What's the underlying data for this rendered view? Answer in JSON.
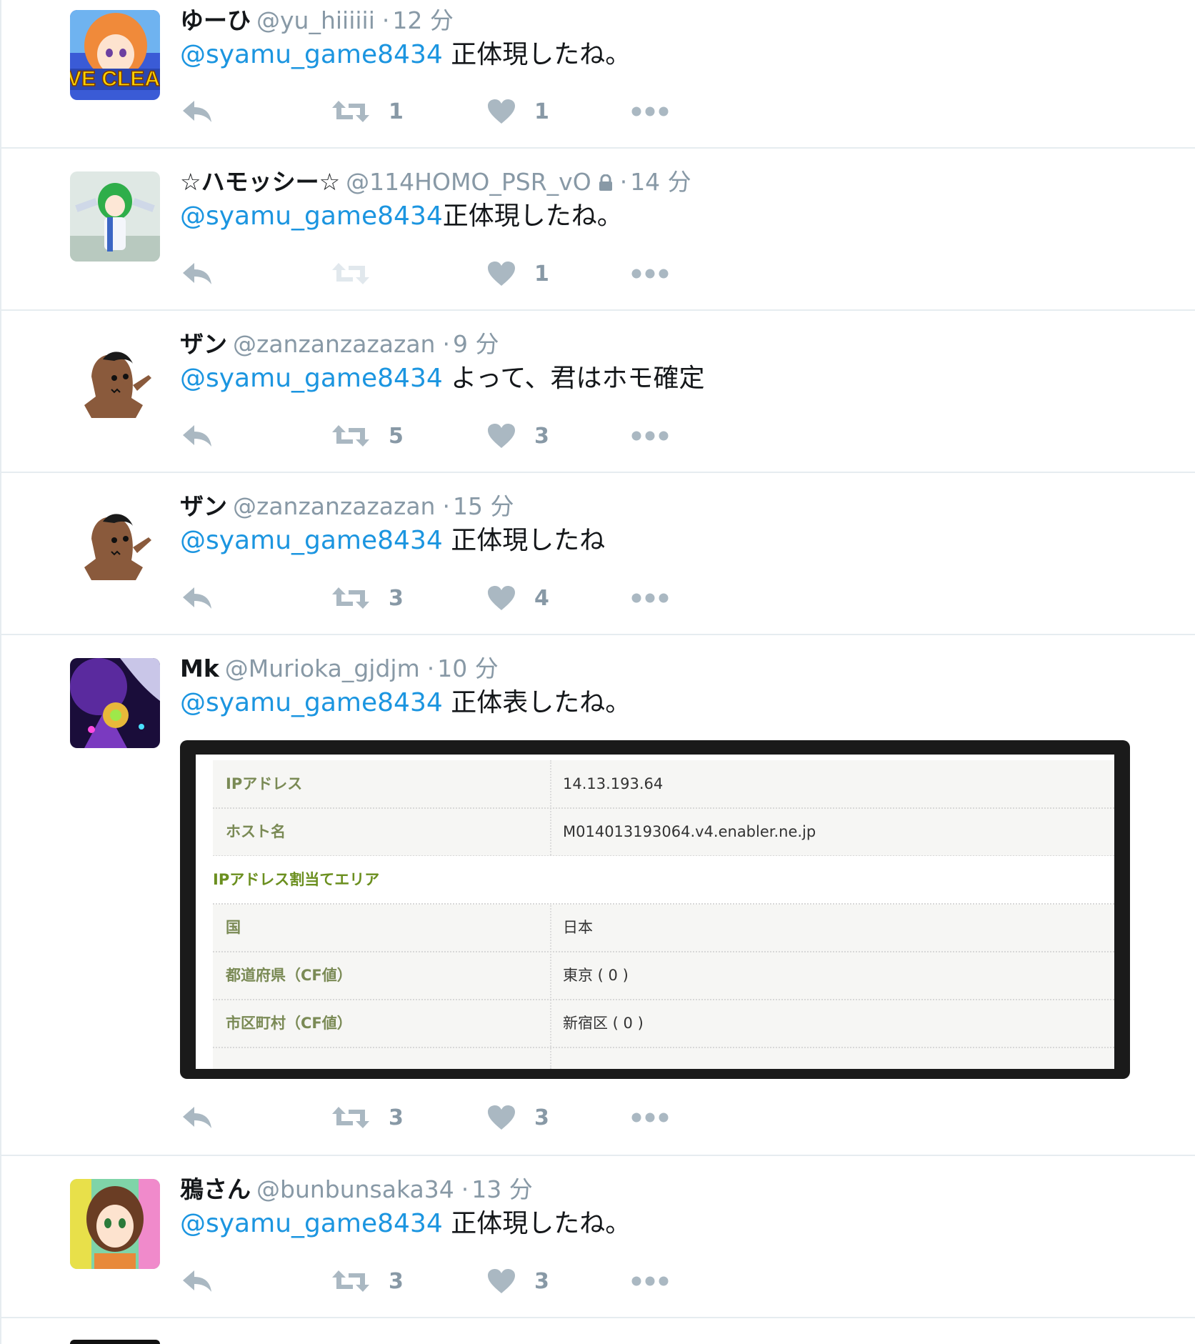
{
  "colors": {
    "mention": "#1b95e0",
    "muted": "#8899a6",
    "divider": "#e6ecf0"
  },
  "tweets": [
    {
      "name": "ゆーひ",
      "handle": "@yu_hiiiiii",
      "time": "12 分",
      "mention": "@syamu_game8434",
      "text": " 正体現したね。",
      "retweets": "1",
      "likes": "1",
      "avatar": "anime-girl-orange-hair",
      "avatar_caption": "VE CLEA"
    },
    {
      "name": "☆ハモッシー☆",
      "handle": "@114HOMO_PSR_vO",
      "protected": true,
      "time": "14 分",
      "mention": "@syamu_game8434",
      "text": "正体現したね。",
      "retweets": "",
      "likes": "1",
      "avatar": "green-hair-3d-figure"
    },
    {
      "name": "ザン",
      "handle": "@zanzanzazazan",
      "time": "9 分",
      "mention": "@syamu_game8434",
      "text": " よって、君はホモ確定",
      "retweets": "5",
      "likes": "3",
      "avatar": "brown-ghost-costume"
    },
    {
      "name": "ザン",
      "handle": "@zanzanzazazan",
      "time": "15 分",
      "mention": "@syamu_game8434",
      "text": " 正体現したね",
      "retweets": "3",
      "likes": "4",
      "avatar": "brown-ghost-costume"
    },
    {
      "name": "Mk",
      "handle": "@Murioka_gjdjm",
      "time": "10 分",
      "mention": "@syamu_game8434",
      "text": " 正体表したね。",
      "retweets": "3",
      "likes": "3",
      "avatar": "purple-fantasy-art",
      "media": {
        "rows": [
          {
            "label": "IPアドレス",
            "value": "14.13.193.64"
          },
          {
            "label": "ホスト名",
            "value": "M014013193064.v4.enabler.ne.jp"
          },
          {
            "section": "IPアドレス割当てエリア"
          },
          {
            "label": "国",
            "value": "日本"
          },
          {
            "label": "都道府県（CF値）",
            "value": "東京 ( 0 )"
          },
          {
            "label": "市区町村（CF値）",
            "value": "新宿区 ( 0 )"
          }
        ]
      }
    },
    {
      "name": "鴉さん",
      "handle": "@bunbunsaka34",
      "time": "13 分",
      "mention": "@syamu_game8434",
      "text": " 正体現したね。",
      "retweets": "3",
      "likes": "3",
      "avatar": "anime-girl-brown-hair"
    }
  ]
}
